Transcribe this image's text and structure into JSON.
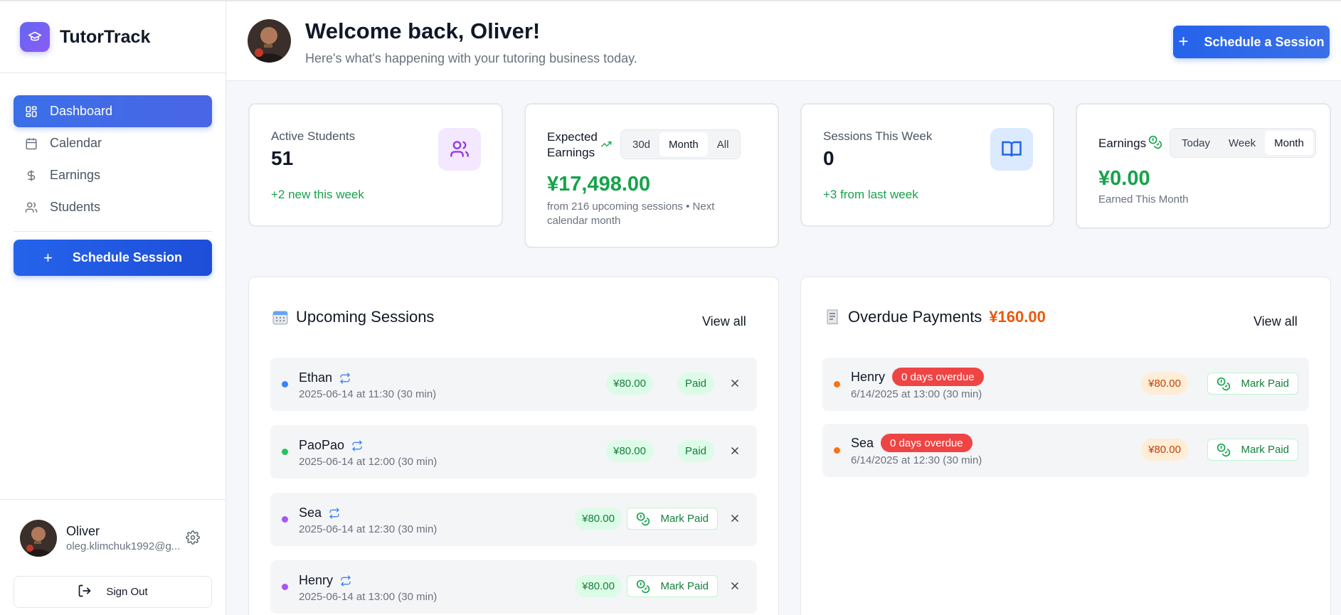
{
  "brand": {
    "name": "TutorTrack"
  },
  "nav": {
    "items": [
      {
        "label": "Dashboard",
        "icon": "dashboard-icon",
        "active": true
      },
      {
        "label": "Calendar",
        "icon": "calendar-icon"
      },
      {
        "label": "Earnings",
        "icon": "dollar-icon"
      },
      {
        "label": "Students",
        "icon": "users-icon"
      }
    ],
    "schedule_label": "Schedule Session"
  },
  "user": {
    "name": "Oliver",
    "email": "oleg.klimchuk1992@g...",
    "signout_label": "Sign Out"
  },
  "header": {
    "title": "Welcome back, Oliver!",
    "subtitle": "Here's what's happening with your tutoring business today.",
    "button_label": "Schedule a Session"
  },
  "stats": {
    "active_students": {
      "label": "Active Students",
      "value": "51",
      "delta": "+2 new this week"
    },
    "expected_earnings": {
      "label": "Expected Earnings",
      "options": [
        "30d",
        "Month",
        "All"
      ],
      "selected": "Month",
      "value": "¥17,498.00",
      "note": "from 216 upcoming sessions • Next calendar month"
    },
    "sessions_week": {
      "label": "Sessions This Week",
      "value": "0",
      "delta": "+3 from last week"
    },
    "earnings": {
      "label": "Earnings",
      "options": [
        "Today",
        "Week",
        "Month"
      ],
      "selected": "Month",
      "value": "¥0.00",
      "note": "Earned This Month"
    }
  },
  "upcoming": {
    "title": "Upcoming Sessions",
    "view_all": "View all",
    "rows": [
      {
        "name": "Ethan",
        "when": "2025-06-14 at 11:30 (30 min)",
        "price": "¥80.00",
        "status": "Paid",
        "dot": "#3b82f6"
      },
      {
        "name": "PaoPao",
        "when": "2025-06-14 at 12:00 (30 min)",
        "price": "¥80.00",
        "status": "Paid",
        "dot": "#22c55e"
      },
      {
        "name": "Sea",
        "when": "2025-06-14 at 12:30 (30 min)",
        "price": "¥80.00",
        "status": "Mark Paid",
        "dot": "#a855f7"
      },
      {
        "name": "Henry",
        "when": "2025-06-14 at 13:00 (30 min)",
        "price": "¥80.00",
        "status": "Mark Paid",
        "dot": "#a855f7"
      }
    ]
  },
  "overdue": {
    "title": "Overdue Payments",
    "total": "¥160.00",
    "view_all": "View all",
    "rows": [
      {
        "name": "Henry",
        "badge": "0 days overdue",
        "when": "6/14/2025 at 13:00 (30 min)",
        "price": "¥80.00",
        "action": "Mark Paid"
      },
      {
        "name": "Sea",
        "badge": "0 days overdue",
        "when": "6/14/2025 at 12:30 (30 min)",
        "price": "¥80.00",
        "action": "Mark Paid"
      }
    ]
  },
  "colors": {
    "primary": "#2563eb",
    "success": "#16a34a",
    "danger": "#ef4444",
    "warning": "#ea580c"
  }
}
